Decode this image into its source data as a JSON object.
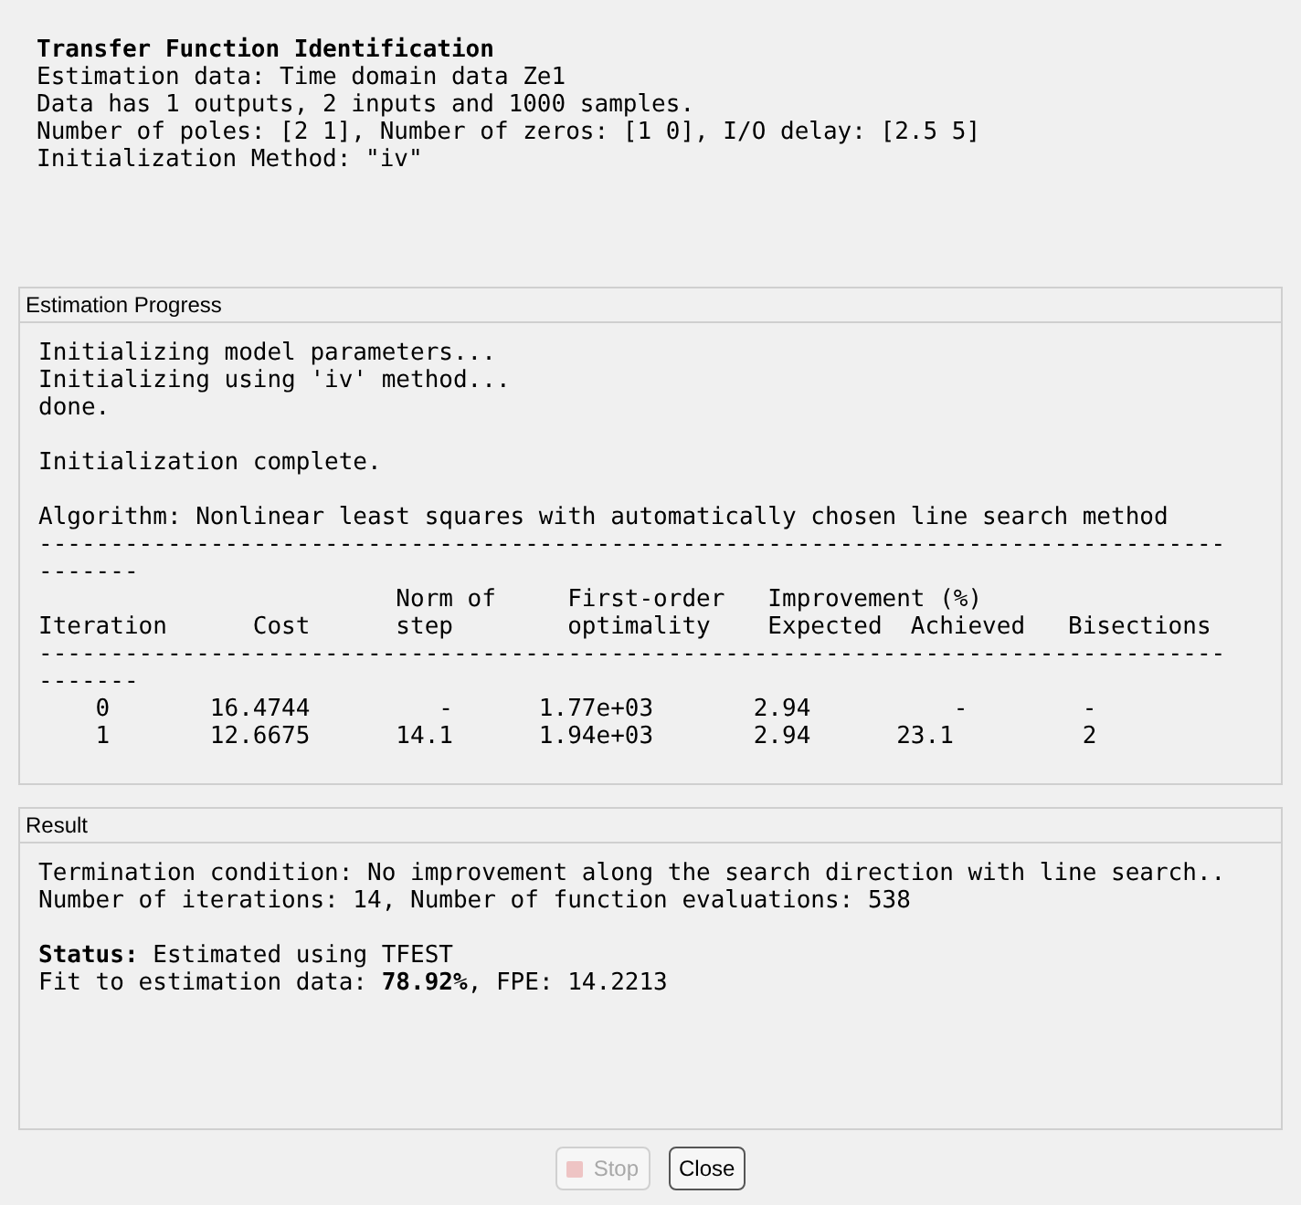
{
  "summary": {
    "title": "Transfer Function Identification",
    "lines": [
      "Estimation data: Time domain data Ze1",
      "Data has 1 outputs, 2 inputs and 1000 samples.",
      "Number of poles: [2 1], Number of zeros: [1 0], I/O delay: [2.5 5]",
      "Initialization Method: \"iv\""
    ]
  },
  "progress": {
    "title": "Estimation Progress",
    "blocks": [
      [
        "Initializing model parameters...",
        "Initializing using 'iv' method...",
        "done."
      ],
      [
        "Initialization complete."
      ],
      [
        "Algorithm: Nonlinear least squares with automatically chosen line search method",
        "-----------------------------------------------------------------------------------",
        "-------",
        "                         Norm of     First-order   Improvement (%)",
        "Iteration      Cost      step        optimality    Expected  Achieved   Bisections",
        "-----------------------------------------------------------------------------------",
        "-------",
        "    0       16.4744         -      1.77e+03       2.94          -        -",
        "    1       12.6675      14.1      1.94e+03       2.94      23.1         2"
      ]
    ]
  },
  "result": {
    "title": "Result",
    "blocks": [
      [
        "Termination condition: No improvement along the search direction with line search..",
        "Number of iterations: 14, Number of function evaluations: 538"
      ],
      [
        "**Status:** Estimated using TFEST",
        "Fit to estimation data: **78.92%**, FPE: 14.2213"
      ]
    ]
  },
  "buttons": [
    {
      "label": "Stop",
      "kind": "stop",
      "disabled": true
    },
    {
      "label": "Close",
      "kind": "plain",
      "disabled": false
    }
  ]
}
